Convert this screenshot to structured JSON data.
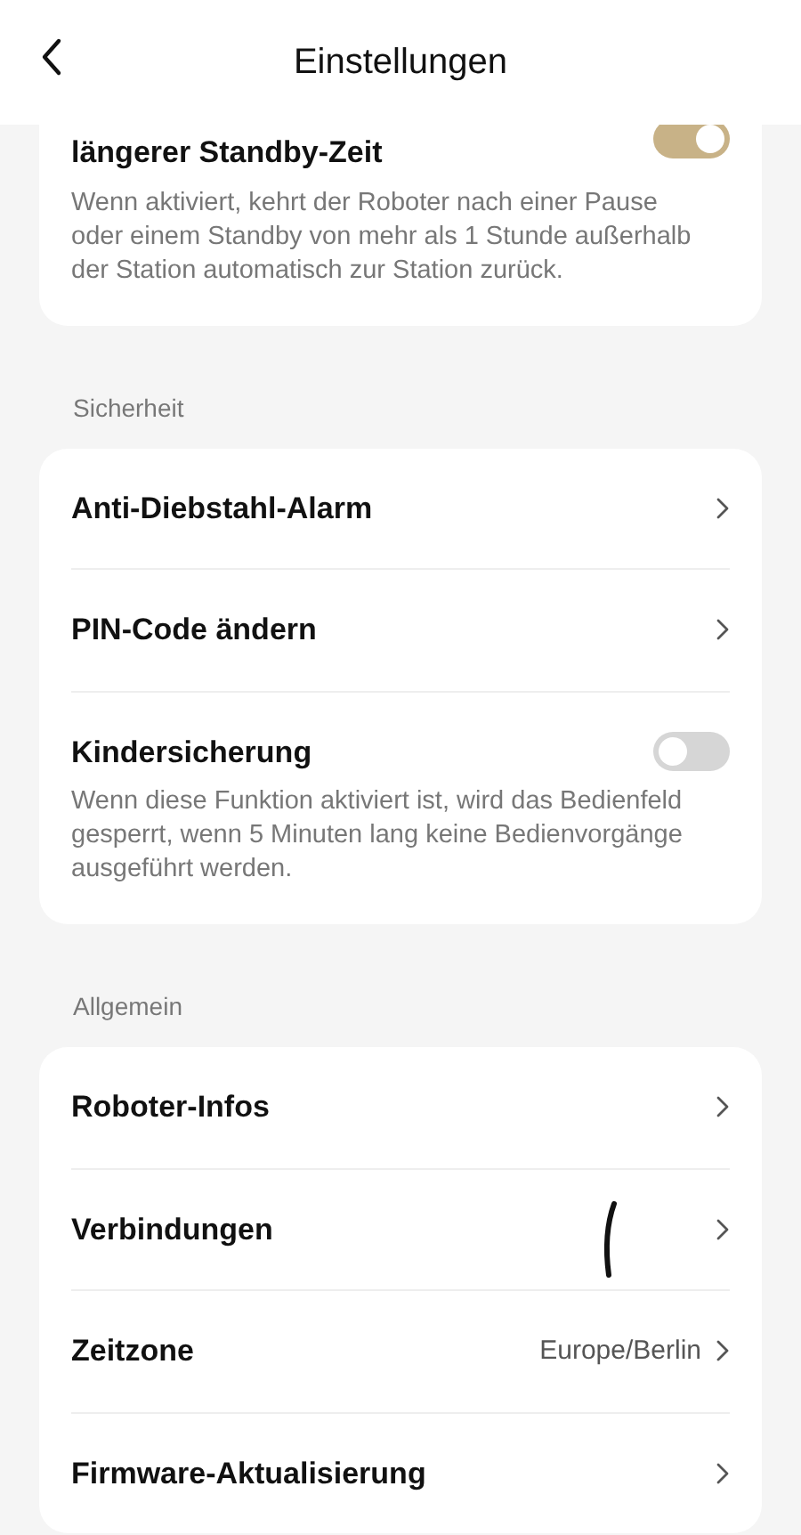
{
  "header": {
    "title": "Einstellungen"
  },
  "sections": [
    {
      "rows": [
        {
          "kind": "toggle",
          "title": "längerer Standby-Zeit",
          "on": true,
          "description": "Wenn aktiviert, kehrt der Roboter nach einer Pause oder einem Standby von mehr als 1 Stunde außerhalb der Station automatisch zur Station zurück."
        }
      ]
    },
    {
      "label": "Sicherheit",
      "rows": [
        {
          "kind": "link",
          "title": "Anti-Diebstahl-Alarm"
        },
        {
          "kind": "link",
          "title": "PIN-Code ändern"
        },
        {
          "kind": "toggle",
          "title": "Kindersicherung",
          "on": false,
          "description": "Wenn diese Funktion aktiviert ist, wird das Bedienfeld gesperrt, wenn 5 Minuten lang keine Bedienvorgänge ausgeführt werden."
        }
      ]
    },
    {
      "label": "Allgemein",
      "rows": [
        {
          "kind": "link",
          "title": "Roboter-Infos"
        },
        {
          "kind": "link",
          "title": "Verbindungen"
        },
        {
          "kind": "link",
          "title": "Zeitzone",
          "value": "Europe/Berlin"
        },
        {
          "kind": "link",
          "title": "Firmware-Aktualisierung"
        }
      ]
    }
  ]
}
